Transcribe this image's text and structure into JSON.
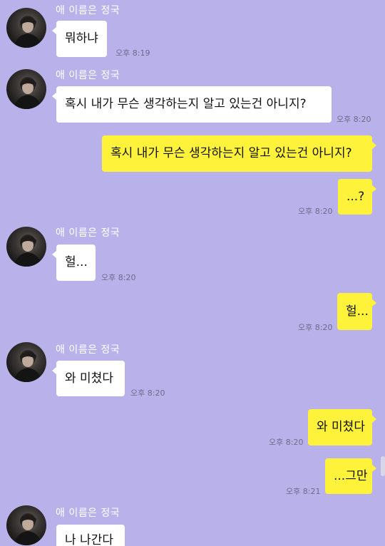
{
  "sender_name": "애 이름은 정국",
  "messages": [
    {
      "side": "in",
      "text": "뭐하냐",
      "time": "오후 8:19"
    },
    {
      "side": "in",
      "text": "혹시 내가 무슨 생각하는지 알고 있는건 아니지?",
      "time": "오후 8:20"
    },
    {
      "side": "out",
      "text": "혹시 내가 무슨 생각하는지 알고 있는건 아니지?",
      "time": ""
    },
    {
      "side": "out",
      "text": "...?",
      "time": "오후 8:20"
    },
    {
      "side": "in",
      "text": "헐...",
      "time": "오후 8:20"
    },
    {
      "side": "out",
      "text": "헐...",
      "time": "오후 8:20"
    },
    {
      "side": "in",
      "text": "와 미쳤다",
      "time": "오후 8:20"
    },
    {
      "side": "out",
      "text": "와 미쳤다",
      "time": "오후 8:20"
    },
    {
      "side": "out",
      "text": "...그만",
      "time": "오후 8:21"
    },
    {
      "side": "in",
      "text": "나 나간다",
      "time": ""
    }
  ],
  "colors": {
    "background": "#b9b1ea",
    "incoming_bubble": "#ffffff",
    "outgoing_bubble": "#fff23a"
  },
  "icons": {
    "avatar": "profile-photo"
  }
}
